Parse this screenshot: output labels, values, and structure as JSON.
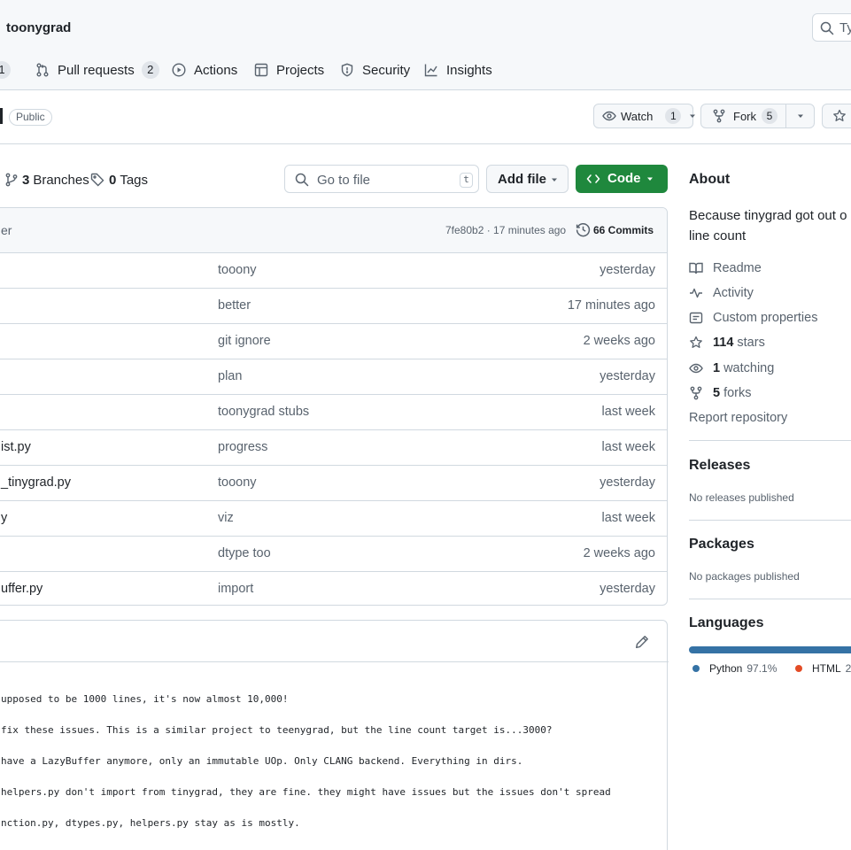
{
  "repo": {
    "name": "toonygrad",
    "visibility": "Public"
  },
  "search": {
    "placeholder": "Ty"
  },
  "nav": {
    "issues_count": "1",
    "pull_requests": {
      "label": "Pull requests",
      "count": "2"
    },
    "actions": "Actions",
    "projects": "Projects",
    "security": "Security",
    "insights": "Insights"
  },
  "repo_actions": {
    "watch": {
      "label": "Watch",
      "count": "1"
    },
    "fork": {
      "label": "Fork",
      "count": "5"
    }
  },
  "branch_bar": {
    "branches_count": "3",
    "branches_label": "Branches",
    "tags_count": "0",
    "tags_label": "Tags",
    "goto_placeholder": "Go to file",
    "goto_shortcut": "t",
    "add_file": "Add file",
    "code": "Code"
  },
  "latest_commit": {
    "author_fragment": "er",
    "hash_time": "7fe80b2 · 17 minutes ago",
    "commits": "66 Commits"
  },
  "files": [
    {
      "name": "",
      "message": "tooony",
      "date": "yesterday"
    },
    {
      "name": "",
      "message": "better",
      "date": "17 minutes ago"
    },
    {
      "name": "",
      "message": "git ignore",
      "date": "2 weeks ago"
    },
    {
      "name": "",
      "message": "plan",
      "date": "yesterday"
    },
    {
      "name": "",
      "message": "toonygrad stubs",
      "date": "last week"
    },
    {
      "name": "ist.py",
      "message": "progress",
      "date": "last week"
    },
    {
      "name": "_tinygrad.py",
      "message": "tooony",
      "date": "yesterday"
    },
    {
      "name": "y",
      "message": "viz",
      "date": "last week"
    },
    {
      "name": "",
      "message": "dtype too",
      "date": "2 weeks ago"
    },
    {
      "name": "uffer.py",
      "message": "import",
      "date": "yesterday"
    }
  ],
  "readme": {
    "lines": [
      "upposed to be 1000 lines, it's now almost 10,000!",
      " fix these issues. This is a similar project to teenygrad, but the line count target is...3000?",
      " have a LazyBuffer anymore, only an immutable UOp. Only CLANG backend. Everything in dirs.",
      "helpers.py don't import from tinygrad, they are fine. they might have issues but the issues don't spread",
      "nction.py, dtypes.py, helpers.py stay as is mostly."
    ]
  },
  "about": {
    "title": "About",
    "description_line1": "Because tinygrad got out o",
    "description_line2": "line count",
    "readme": "Readme",
    "activity": "Activity",
    "custom_properties": "Custom properties",
    "stars_count": "114",
    "stars_label": "stars",
    "watching_count": "1",
    "watching_label": "watching",
    "forks_count": "5",
    "forks_label": "forks",
    "report": "Report repository"
  },
  "releases": {
    "title": "Releases",
    "empty": "No releases published"
  },
  "packages": {
    "title": "Packages",
    "empty": "No packages published"
  },
  "languages": {
    "title": "Languages",
    "items": [
      {
        "name": "Python",
        "percent": "97.1%",
        "color": "#3572A5"
      },
      {
        "name": "HTML",
        "percent": "2.",
        "color": "#e34c26"
      }
    ]
  }
}
